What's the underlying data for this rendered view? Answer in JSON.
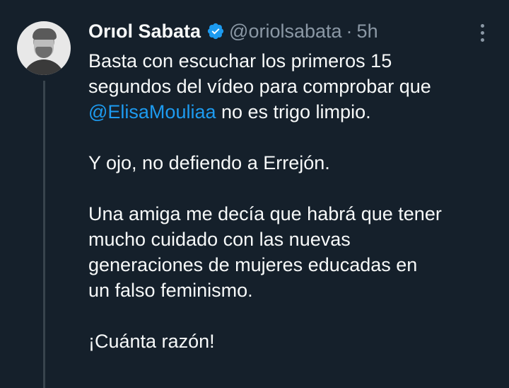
{
  "tweet": {
    "author_name": "Orıol Sabata",
    "handle": "@oriolsabata",
    "separator": "·",
    "time": "5h",
    "verified": true,
    "icons": {
      "verified": "verified-badge-icon",
      "more": "more-options-icon"
    },
    "colors": {
      "background": "#15202b",
      "text": "#f7f9f9",
      "secondary": "#8b98a5",
      "link": "#1d9bf0",
      "thread_line": "#38444d"
    },
    "body": {
      "p1_line1": "Basta con escuchar los primeros 15",
      "p1_line2": "segundos del vídeo para comprobar que",
      "mention": "@ElisaMouliaa",
      "p1_line3_rest": " no es trigo limpio.",
      "p2_line1": "Y ojo, no defiendo a Errejón.",
      "p3_line1": "Una amiga me decía que habrá que tener",
      "p3_line2": "mucho cuidado con las nuevas",
      "p3_line3": "generaciones de mujeres educadas en",
      "p3_line4": "un falso feminismo.",
      "p4_line1": "¡Cuánta razón!"
    }
  }
}
